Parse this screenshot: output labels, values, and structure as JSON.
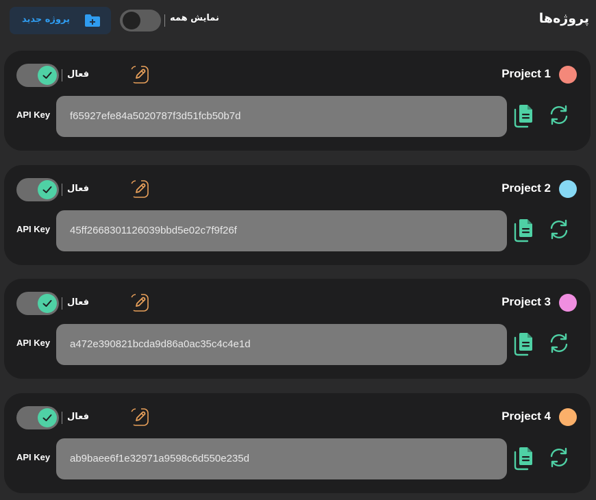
{
  "header": {
    "title": "پروژه‌ها",
    "show_all_label": "نمایش همه",
    "show_all_on": false,
    "new_project_label": "پروژه جدید",
    "new_project_icon": "folder-plus-icon"
  },
  "colors": {
    "background": "#2a2a2b",
    "card": "#1e1e1f",
    "accent": "#4fd1a5",
    "edit": "#e8a05a",
    "button_text": "#2f9cf0"
  },
  "projects": [
    {
      "name": "Project 1",
      "color": "#f4887a",
      "active_label": "فعال",
      "active": true,
      "api_key_label": "API Key",
      "api_key": "f65927efe84a5020787f3d51fcb50b7d"
    },
    {
      "name": "Project 2",
      "color": "#86d8f4",
      "active_label": "فعال",
      "active": true,
      "api_key_label": "API Key",
      "api_key": "45ff2668301126039bbd5e02c7f9f26f"
    },
    {
      "name": "Project 3",
      "color": "#f08ee0",
      "active_label": "فعال",
      "active": true,
      "api_key_label": "API Key",
      "api_key": "a472e390821bcda9d86a0ac35c4c4e1d"
    },
    {
      "name": "Project 4",
      "color": "#fbb06a",
      "active_label": "فعال",
      "active": true,
      "api_key_label": "API Key",
      "api_key": "ab9baee6f1e32971a9598c6d550e235d"
    }
  ]
}
